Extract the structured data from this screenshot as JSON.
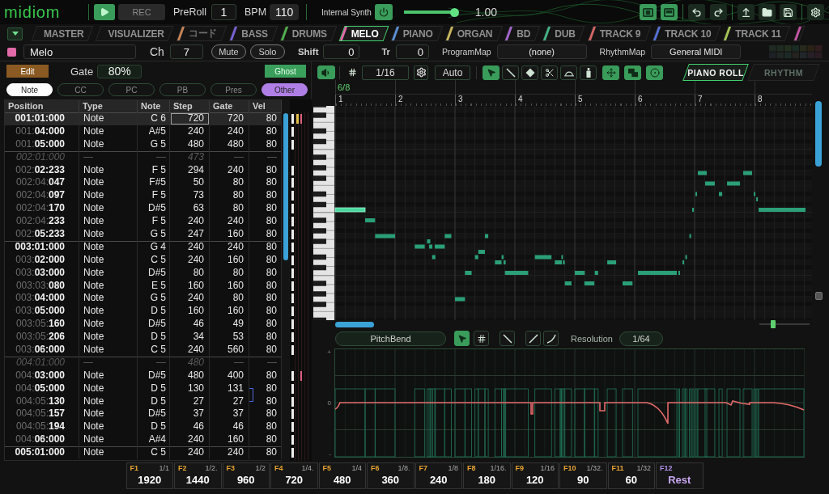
{
  "header": {
    "logo": "midiom",
    "rec_button": "REC",
    "preroll": {
      "label": "PreRoll",
      "value": "1"
    },
    "bpm": {
      "label": "BPM",
      "value": "110"
    },
    "synth": {
      "label": "Internal Synth",
      "on": true,
      "level": 1,
      "reading": "1.00"
    }
  },
  "track_tabs": [
    {
      "label": "MASTER",
      "selected": false,
      "dimmed": false
    },
    {
      "label": "VISUALIZER",
      "selected": false,
      "dimmed": false
    },
    {
      "label": "コード",
      "color": "#c8865a",
      "selected": false,
      "dimmed": true
    },
    {
      "label": "BASS",
      "color": "#7b62d6",
      "selected": false,
      "dimmed": false
    },
    {
      "label": "DRUMS",
      "color": "#52b04e",
      "selected": false,
      "dimmed": false
    },
    {
      "label": "MELO",
      "color": "#e26aa8",
      "selected": true,
      "dimmed": false
    },
    {
      "label": "PIANO",
      "color": "#5b8ed4",
      "selected": false,
      "dimmed": false
    },
    {
      "label": "ORGAN",
      "color": "#c9b85e",
      "selected": false,
      "dimmed": false
    },
    {
      "label": "BD",
      "color": "#a466cc",
      "selected": false,
      "dimmed": false
    },
    {
      "label": "DUB",
      "color": "#44b486",
      "selected": false,
      "dimmed": false
    },
    {
      "label": "TRACK 9",
      "color": "#d46666",
      "selected": false,
      "dimmed": false
    },
    {
      "label": "TRACK 10",
      "color": "#5672d6",
      "selected": false,
      "dimmed": false
    },
    {
      "label": "TRACK 11",
      "color": "#a4c456",
      "selected": false,
      "dimmed": false
    },
    {
      "color": "#c456a4",
      "selected": false
    }
  ],
  "track": {
    "name": "Melo",
    "channel": {
      "label": "Ch",
      "value": "7"
    },
    "mute": {
      "label": "Mute",
      "on": false
    },
    "solo": {
      "label": "Solo",
      "on": false
    },
    "shift": {
      "label": "Shift",
      "value": "0"
    },
    "transpose": {
      "label": "Tr",
      "value": "0"
    },
    "program_map": {
      "label": "ProgramMap",
      "value": "(none)"
    },
    "rhythm_map": {
      "label": "RhythmMap",
      "value": "General MIDI"
    }
  },
  "event_list": {
    "edit_button": "Edit",
    "gate": {
      "label": "Gate",
      "value": "80%"
    },
    "ghost": {
      "label": "Ghost",
      "on": true
    },
    "filters": [
      {
        "label": "Note",
        "selected": true,
        "color": "#ffffff"
      },
      {
        "label": "CC",
        "selected": false
      },
      {
        "label": "PC",
        "selected": false
      },
      {
        "label": "PB",
        "selected": false
      },
      {
        "label": "Pres",
        "selected": false
      },
      {
        "label": "Other",
        "selected": true,
        "color": "#b07fe6"
      }
    ],
    "columns": [
      "Position",
      "Type",
      "Note",
      "Step",
      "Gate",
      "Vel"
    ],
    "rows": [
      {
        "kind": "note",
        "position": "001:01:000",
        "type": "Note",
        "note": "C 6",
        "step": "720",
        "gate": "720",
        "vel": "80",
        "selected": true,
        "bar_start": true,
        "bracket": false,
        "markers": [
          {
            "color": "#e2c04a"
          },
          {
            "color": "#e0607e"
          }
        ]
      },
      {
        "kind": "note",
        "position": "001:**04:000**",
        "type": "Note",
        "note": "A#5",
        "step": "240",
        "gate": "240",
        "vel": "80",
        "selected": false,
        "bar_start": false,
        "bracket": false
      },
      {
        "kind": "note",
        "position": "001:**05:000**",
        "type": "Note",
        "note": "G 5",
        "step": "480",
        "gate": "480",
        "vel": "80",
        "selected": false,
        "bar_start": false,
        "bracket": false
      },
      {
        "kind": "marker",
        "position": "002:01:000",
        "type": "—",
        "note": "—",
        "step": "473",
        "gate": "—",
        "vel": "—",
        "selected": false,
        "bar_start": true,
        "bracket": false
      },
      {
        "kind": "note",
        "position": "002:**02:233**",
        "type": "Note",
        "note": "F 5",
        "step": "294",
        "gate": "240",
        "vel": "80",
        "selected": false,
        "bar_start": false,
        "bracket": false
      },
      {
        "kind": "note",
        "position": "002:04:**047**",
        "type": "Note",
        "note": "F#5",
        "step": "50",
        "gate": "80",
        "vel": "80",
        "selected": false,
        "bar_start": false,
        "bracket": false
      },
      {
        "kind": "note",
        "position": "002:04:**097**",
        "type": "Note",
        "note": "F 5",
        "step": "73",
        "gate": "80",
        "vel": "80",
        "selected": false,
        "bar_start": false,
        "bracket": false
      },
      {
        "kind": "note",
        "position": "002:04:**170**",
        "type": "Note",
        "note": "D#5",
        "step": "63",
        "gate": "80",
        "vel": "80",
        "selected": false,
        "bar_start": false,
        "bracket": false
      },
      {
        "kind": "note",
        "position": "002:04:**233**",
        "type": "Note",
        "note": "F 5",
        "step": "240",
        "gate": "240",
        "vel": "80",
        "selected": false,
        "bar_start": false,
        "bracket": false
      },
      {
        "kind": "note",
        "position": "002:**05:233**",
        "type": "Note",
        "note": "G 5",
        "step": "247",
        "gate": "160",
        "vel": "80",
        "selected": false,
        "bar_start": false,
        "bracket": false
      },
      {
        "kind": "note",
        "position": "003:01:000",
        "type": "Note",
        "note": "G 4",
        "step": "240",
        "gate": "240",
        "vel": "80",
        "selected": false,
        "bar_start": true,
        "bracket": false
      },
      {
        "kind": "note",
        "position": "003:**02:000**",
        "type": "Note",
        "note": "C 5",
        "step": "240",
        "gate": "160",
        "vel": "80",
        "selected": false,
        "bar_start": false,
        "bracket": false
      },
      {
        "kind": "note",
        "position": "003:**03:000**",
        "type": "Note",
        "note": "D#5",
        "step": "80",
        "gate": "80",
        "vel": "80",
        "selected": false,
        "bar_start": false,
        "bracket": false
      },
      {
        "kind": "note",
        "position": "003:03:**080**",
        "type": "Note",
        "note": "E 5",
        "step": "160",
        "gate": "160",
        "vel": "80",
        "selected": false,
        "bar_start": false,
        "bracket": false
      },
      {
        "kind": "note",
        "position": "003:**04:000**",
        "type": "Note",
        "note": "G 5",
        "step": "240",
        "gate": "80",
        "vel": "80",
        "selected": false,
        "bar_start": false,
        "bracket": false
      },
      {
        "kind": "note",
        "position": "003:**05:000**",
        "type": "Note",
        "note": "D 5",
        "step": "160",
        "gate": "160",
        "vel": "80",
        "selected": false,
        "bar_start": false,
        "bracket": false
      },
      {
        "kind": "note",
        "position": "003:05:**160**",
        "type": "Note",
        "note": "D#5",
        "step": "46",
        "gate": "49",
        "vel": "80",
        "selected": false,
        "bar_start": false,
        "bracket": false
      },
      {
        "kind": "note",
        "position": "003:05:**206**",
        "type": "Note",
        "note": "D 5",
        "step": "34",
        "gate": "53",
        "vel": "80",
        "selected": false,
        "bar_start": false,
        "bracket": false
      },
      {
        "kind": "note",
        "position": "003:**06:000**",
        "type": "Note",
        "note": "C 5",
        "step": "240",
        "gate": "560",
        "vel": "80",
        "selected": false,
        "bar_start": false,
        "bracket": false
      },
      {
        "kind": "marker",
        "position": "004:01:000",
        "type": "—",
        "note": "—",
        "step": "480",
        "gate": "—",
        "vel": "—",
        "selected": false,
        "bar_start": true,
        "bracket": false
      },
      {
        "kind": "note",
        "position": "004:**03:000**",
        "type": "Note",
        "note": "D#5",
        "step": "480",
        "gate": "400",
        "vel": "80",
        "selected": false,
        "bar_start": false,
        "bracket": false,
        "markers": [
          {
            "color": "#e0607e"
          }
        ]
      },
      {
        "kind": "note",
        "position": "004:**05:000**",
        "type": "Note",
        "note": "D 5",
        "step": "130",
        "gate": "131",
        "vel": "80",
        "selected": false,
        "bar_start": false,
        "bracket": true
      },
      {
        "kind": "note",
        "position": "004:05:**130**",
        "type": "Note",
        "note": "D 5",
        "step": "27",
        "gate": "27",
        "vel": "80",
        "selected": false,
        "bar_start": false,
        "bracket": false
      },
      {
        "kind": "note",
        "position": "004:05:**157**",
        "type": "Note",
        "note": "D#5",
        "step": "37",
        "gate": "37",
        "vel": "80",
        "selected": false,
        "bar_start": false,
        "bracket": false
      },
      {
        "kind": "note",
        "position": "004:05:**194**",
        "type": "Note",
        "note": "D 5",
        "step": "46",
        "gate": "46",
        "vel": "80",
        "selected": false,
        "bar_start": false,
        "bracket": false
      },
      {
        "kind": "note",
        "position": "004:**06:000**",
        "type": "Note",
        "note": "A#4",
        "step": "240",
        "gate": "160",
        "vel": "80",
        "selected": false,
        "bar_start": false,
        "bracket": false
      },
      {
        "kind": "note",
        "position": "005:01:000",
        "type": "Note",
        "note": "C 5",
        "step": "240",
        "gate": "240",
        "vel": "80",
        "selected": false,
        "bar_start": true,
        "bracket": false
      }
    ]
  },
  "piano_roll": {
    "speaker_button": {
      "on": true
    },
    "snap": "1/16",
    "auto_button": "Auto",
    "tools": [
      {
        "kind": "pointer",
        "selected": true
      },
      {
        "kind": "line",
        "selected": false
      },
      {
        "kind": "eraser",
        "selected": false
      },
      {
        "kind": "scissors",
        "selected": false
      },
      {
        "kind": "arc",
        "selected": false
      },
      {
        "kind": "glue",
        "selected": false
      }
    ],
    "toggles": [
      {
        "kind": "move",
        "on": true
      },
      {
        "kind": "copy",
        "on": true
      },
      {
        "kind": "target",
        "on": true
      }
    ],
    "view_tabs": [
      {
        "label": "PIANO ROLL",
        "selected": true
      },
      {
        "label": "RHYTHM",
        "selected": false
      }
    ],
    "time_signature": "6/8",
    "bars": [
      "1",
      "2",
      "3",
      "4",
      "5",
      "6",
      "7",
      "8"
    ],
    "zoom_slider": {
      "level": 0.28
    }
  },
  "controller_lane": {
    "type": "PitchBend",
    "tools": [
      {
        "kind": "pointer",
        "selected": true
      },
      {
        "kind": "grid",
        "selected": false
      },
      {
        "kind": "line",
        "selected": false
      },
      {
        "kind": "ramp",
        "selected": false
      },
      {
        "kind": "curve",
        "selected": false
      }
    ],
    "resolution": {
      "label": "Resolution",
      "value": "1/64"
    },
    "axis_labels": [
      "+",
      "0",
      "-"
    ]
  },
  "function_keys": [
    {
      "key": "F1",
      "fraction": "1/1",
      "value": "1920",
      "kind": "length"
    },
    {
      "key": "F2",
      "fraction": "1/2.",
      "value": "1440",
      "kind": "length"
    },
    {
      "key": "F3",
      "fraction": "1/2",
      "value": "960",
      "kind": "length"
    },
    {
      "key": "F4",
      "fraction": "1/4.",
      "value": "720",
      "kind": "length"
    },
    {
      "key": "F5",
      "fraction": "1/4",
      "value": "480",
      "kind": "length"
    },
    {
      "key": "F6",
      "fraction": "1/8.",
      "value": "360",
      "kind": "length"
    },
    {
      "key": "F7",
      "fraction": "1/8",
      "value": "240",
      "kind": "length"
    },
    {
      "key": "F8",
      "fraction": "1/16.",
      "value": "180",
      "kind": "length"
    },
    {
      "key": "F9",
      "fraction": "1/16",
      "value": "120",
      "kind": "length"
    },
    {
      "key": "F10",
      "fraction": "1/32.",
      "value": "90",
      "kind": "length"
    },
    {
      "key": "F11",
      "fraction": "1/32",
      "value": "60",
      "kind": "length"
    },
    {
      "key": "F12",
      "value": "Rest",
      "kind": "rest"
    }
  ]
}
